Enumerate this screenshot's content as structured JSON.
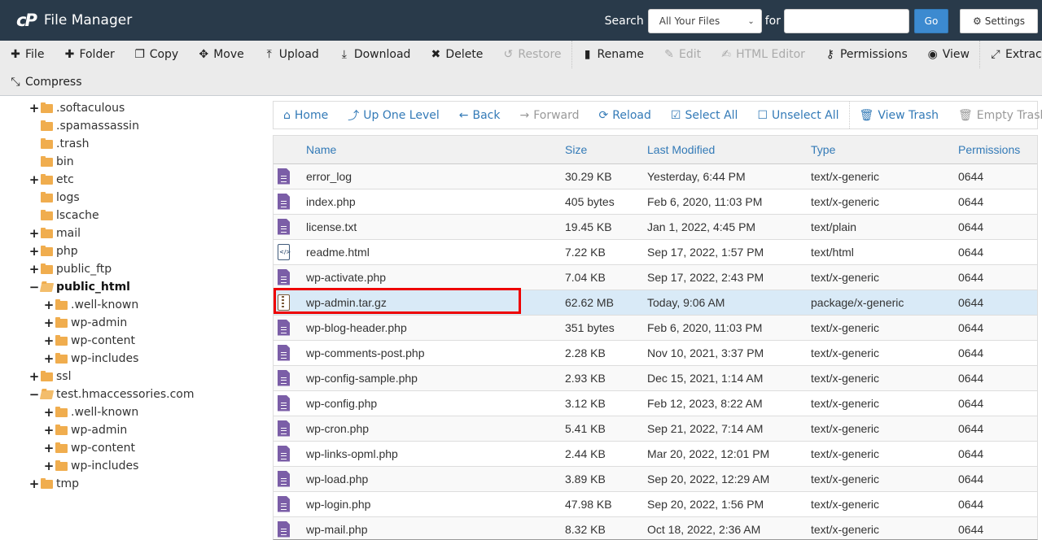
{
  "header": {
    "logo": "cP",
    "title": "File Manager",
    "search_label": "Search",
    "search_scope": "All Your Files",
    "for_label": "for",
    "search_value": "",
    "go_label": "Go",
    "settings_label": "Settings"
  },
  "toolbar": {
    "row1": [
      {
        "label": "File",
        "icon": "plus-icon",
        "glyph": "✚",
        "disabled": false
      },
      {
        "label": "Folder",
        "icon": "plus-icon",
        "glyph": "✚",
        "disabled": false
      },
      {
        "label": "Copy",
        "icon": "copy-icon",
        "glyph": "❐",
        "disabled": false
      },
      {
        "label": "Move",
        "icon": "move-icon",
        "glyph": "✥",
        "disabled": false
      },
      {
        "label": "Upload",
        "icon": "upload-icon",
        "glyph": "⤒",
        "disabled": false
      },
      {
        "label": "Download",
        "icon": "download-icon",
        "glyph": "⤓",
        "disabled": false
      },
      {
        "label": "Delete",
        "icon": "delete-icon",
        "glyph": "✖",
        "disabled": false
      },
      {
        "label": "Restore",
        "icon": "restore-icon",
        "glyph": "↺",
        "disabled": true
      },
      {
        "sep": true
      },
      {
        "label": "Rename",
        "icon": "rename-icon",
        "glyph": "▮",
        "disabled": false
      },
      {
        "label": "Edit",
        "icon": "pencil-icon",
        "glyph": "✎",
        "disabled": true
      },
      {
        "label": "HTML Editor",
        "icon": "html-editor-icon",
        "glyph": "✍",
        "disabled": true
      },
      {
        "label": "Permissions",
        "icon": "key-icon",
        "glyph": "⚷",
        "disabled": false
      },
      {
        "label": "View",
        "icon": "eye-icon",
        "glyph": "◉",
        "disabled": false
      },
      {
        "sep": true
      },
      {
        "label": "Extract",
        "icon": "extract-icon",
        "glyph": "⤢",
        "disabled": false
      }
    ],
    "row2": [
      {
        "label": "Compress",
        "icon": "compress-icon",
        "glyph": "⤡",
        "disabled": false
      }
    ]
  },
  "tree": [
    {
      "label": ".softaculous",
      "level": 1,
      "toggle": "+",
      "open": false,
      "bold": false
    },
    {
      "label": ".spamassassin",
      "level": 1,
      "toggle": "",
      "open": false,
      "bold": false
    },
    {
      "label": ".trash",
      "level": 1,
      "toggle": "",
      "open": false,
      "bold": false
    },
    {
      "label": "bin",
      "level": 1,
      "toggle": "",
      "open": false,
      "bold": false
    },
    {
      "label": "etc",
      "level": 1,
      "toggle": "+",
      "open": false,
      "bold": false
    },
    {
      "label": "logs",
      "level": 1,
      "toggle": "",
      "open": false,
      "bold": false
    },
    {
      "label": "lscache",
      "level": 1,
      "toggle": "",
      "open": false,
      "bold": false
    },
    {
      "label": "mail",
      "level": 1,
      "toggle": "+",
      "open": false,
      "bold": false
    },
    {
      "label": "php",
      "level": 1,
      "toggle": "+",
      "open": false,
      "bold": false
    },
    {
      "label": "public_ftp",
      "level": 1,
      "toggle": "+",
      "open": false,
      "bold": false
    },
    {
      "label": "public_html",
      "level": 1,
      "toggle": "−",
      "open": true,
      "bold": true
    },
    {
      "label": ".well-known",
      "level": 2,
      "toggle": "+",
      "open": false,
      "bold": false
    },
    {
      "label": "wp-admin",
      "level": 2,
      "toggle": "+",
      "open": false,
      "bold": false
    },
    {
      "label": "wp-content",
      "level": 2,
      "toggle": "+",
      "open": false,
      "bold": false
    },
    {
      "label": "wp-includes",
      "level": 2,
      "toggle": "+",
      "open": false,
      "bold": false
    },
    {
      "label": "ssl",
      "level": 1,
      "toggle": "+",
      "open": false,
      "bold": false
    },
    {
      "label": "test.hmaccessories.com",
      "level": 1,
      "toggle": "−",
      "open": true,
      "bold": false
    },
    {
      "label": ".well-known",
      "level": 2,
      "toggle": "+",
      "open": false,
      "bold": false
    },
    {
      "label": "wp-admin",
      "level": 2,
      "toggle": "+",
      "open": false,
      "bold": false
    },
    {
      "label": "wp-content",
      "level": 2,
      "toggle": "+",
      "open": false,
      "bold": false
    },
    {
      "label": "wp-includes",
      "level": 2,
      "toggle": "+",
      "open": false,
      "bold": false
    },
    {
      "label": "tmp",
      "level": 1,
      "toggle": "+",
      "open": false,
      "bold": false
    }
  ],
  "nav": [
    {
      "label": "Home",
      "icon": "home-icon",
      "glyph": "⌂",
      "disabled": false
    },
    {
      "label": "Up One Level",
      "icon": "level-up-icon",
      "glyph": "⤴",
      "disabled": false
    },
    {
      "label": "Back",
      "icon": "arrow-left-icon",
      "glyph": "←",
      "disabled": false
    },
    {
      "label": "Forward",
      "icon": "arrow-right-icon",
      "glyph": "→",
      "disabled": true
    },
    {
      "label": "Reload",
      "icon": "reload-icon",
      "glyph": "⟳",
      "disabled": false
    },
    {
      "label": "Select All",
      "icon": "checkbox-checked-icon",
      "glyph": "☑",
      "disabled": false
    },
    {
      "label": "Unselect All",
      "icon": "checkbox-empty-icon",
      "glyph": "☐",
      "disabled": false
    },
    {
      "sep": true
    },
    {
      "label": "View Trash",
      "icon": "trash-icon",
      "glyph": "🗑",
      "disabled": false
    },
    {
      "label": "Empty Trash",
      "icon": "trash-icon",
      "glyph": "🗑",
      "disabled": true
    }
  ],
  "table": {
    "columns": [
      "Name",
      "Size",
      "Last Modified",
      "Type",
      "Permissions"
    ],
    "rows": [
      {
        "icon": "text",
        "name": "error_log",
        "size": "30.29 KB",
        "modified": "Yesterday, 6:44 PM",
        "type": "text/x-generic",
        "perms": "0644",
        "selected": false
      },
      {
        "icon": "text",
        "name": "index.php",
        "size": "405 bytes",
        "modified": "Feb 6, 2020, 11:03 PM",
        "type": "text/x-generic",
        "perms": "0644",
        "selected": false
      },
      {
        "icon": "text",
        "name": "license.txt",
        "size": "19.45 KB",
        "modified": "Jan 1, 2022, 4:45 PM",
        "type": "text/plain",
        "perms": "0644",
        "selected": false
      },
      {
        "icon": "html",
        "name": "readme.html",
        "size": "7.22 KB",
        "modified": "Sep 17, 2022, 1:57 PM",
        "type": "text/html",
        "perms": "0644",
        "selected": false
      },
      {
        "icon": "text",
        "name": "wp-activate.php",
        "size": "7.04 KB",
        "modified": "Sep 17, 2022, 2:43 PM",
        "type": "text/x-generic",
        "perms": "0644",
        "selected": false
      },
      {
        "icon": "archive",
        "name": "wp-admin.tar.gz",
        "size": "62.62 MB",
        "modified": "Today, 9:06 AM",
        "type": "package/x-generic",
        "perms": "0644",
        "selected": true
      },
      {
        "icon": "text",
        "name": "wp-blog-header.php",
        "size": "351 bytes",
        "modified": "Feb 6, 2020, 11:03 PM",
        "type": "text/x-generic",
        "perms": "0644",
        "selected": false
      },
      {
        "icon": "text",
        "name": "wp-comments-post.php",
        "size": "2.28 KB",
        "modified": "Nov 10, 2021, 3:37 PM",
        "type": "text/x-generic",
        "perms": "0644",
        "selected": false
      },
      {
        "icon": "text",
        "name": "wp-config-sample.php",
        "size": "2.93 KB",
        "modified": "Dec 15, 2021, 1:14 AM",
        "type": "text/x-generic",
        "perms": "0644",
        "selected": false
      },
      {
        "icon": "text",
        "name": "wp-config.php",
        "size": "3.12 KB",
        "modified": "Feb 12, 2023, 8:22 AM",
        "type": "text/x-generic",
        "perms": "0644",
        "selected": false
      },
      {
        "icon": "text",
        "name": "wp-cron.php",
        "size": "5.41 KB",
        "modified": "Sep 21, 2022, 7:14 AM",
        "type": "text/x-generic",
        "perms": "0644",
        "selected": false
      },
      {
        "icon": "text",
        "name": "wp-links-opml.php",
        "size": "2.44 KB",
        "modified": "Mar 20, 2022, 12:01 PM",
        "type": "text/x-generic",
        "perms": "0644",
        "selected": false
      },
      {
        "icon": "text",
        "name": "wp-load.php",
        "size": "3.89 KB",
        "modified": "Sep 20, 2022, 12:29 AM",
        "type": "text/x-generic",
        "perms": "0644",
        "selected": false
      },
      {
        "icon": "text",
        "name": "wp-login.php",
        "size": "47.98 KB",
        "modified": "Sep 20, 2022, 1:56 PM",
        "type": "text/x-generic",
        "perms": "0644",
        "selected": false
      },
      {
        "icon": "text",
        "name": "wp-mail.php",
        "size": "8.32 KB",
        "modified": "Oct 18, 2022, 2:36 AM",
        "type": "text/x-generic",
        "perms": "0644",
        "selected": false
      }
    ]
  },
  "colors": {
    "header_bg": "#293a4a",
    "accent": "#337ab7",
    "selected_row": "#d9eaf7",
    "highlight": "#ee0000",
    "folder": "#f0ad4e",
    "file_icon": "#7b5ea7"
  }
}
